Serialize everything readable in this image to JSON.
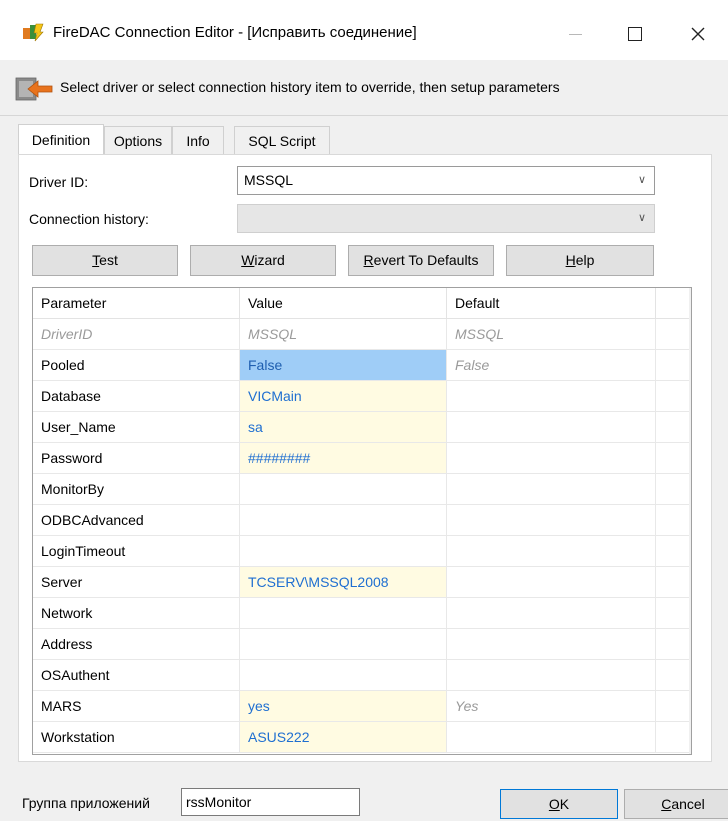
{
  "window": {
    "title": "FireDAC Connection Editor - [Исправить соединение]",
    "app_icon": "firedac-app-icon"
  },
  "info_bar": {
    "text": "Select driver or select connection history item to override, then setup parameters",
    "icon": "arrow-into-box-icon"
  },
  "tabs": [
    {
      "label": "Definition",
      "active": true
    },
    {
      "label": "Options",
      "active": false
    },
    {
      "label": "Info",
      "active": false
    },
    {
      "label": "SQL Script",
      "active": false
    }
  ],
  "driver": {
    "label": "Driver ID:",
    "value": "MSSQL"
  },
  "history": {
    "label": "Connection history:",
    "value": ""
  },
  "buttons": {
    "test": "Test",
    "wizard": "Wizard",
    "revert": "Revert To Defaults",
    "help": "Help"
  },
  "grid": {
    "headers": [
      "Parameter",
      "Value",
      "Default"
    ],
    "rows": [
      {
        "parameter": "DriverID",
        "value": "MSSQL",
        "default": "MSSQL",
        "state": "default"
      },
      {
        "parameter": "Pooled",
        "value": "False",
        "default": "False",
        "state": "selected"
      },
      {
        "parameter": "Database",
        "value": "VICMain",
        "default": "",
        "state": "modified"
      },
      {
        "parameter": "User_Name",
        "value": "sa",
        "default": "",
        "state": "modified"
      },
      {
        "parameter": "Password",
        "value": "########",
        "default": "",
        "state": "modified"
      },
      {
        "parameter": "MonitorBy",
        "value": "",
        "default": "",
        "state": "normal"
      },
      {
        "parameter": "ODBCAdvanced",
        "value": "",
        "default": "",
        "state": "normal"
      },
      {
        "parameter": "LoginTimeout",
        "value": "",
        "default": "",
        "state": "normal"
      },
      {
        "parameter": "Server",
        "value": "TCSERV\\MSSQL2008",
        "default": "",
        "state": "modified"
      },
      {
        "parameter": "Network",
        "value": "",
        "default": "",
        "state": "normal"
      },
      {
        "parameter": "Address",
        "value": "",
        "default": "",
        "state": "normal"
      },
      {
        "parameter": "OSAuthent",
        "value": "",
        "default": "",
        "state": "normal"
      },
      {
        "parameter": "MARS",
        "value": "yes",
        "default": "Yes",
        "state": "modified"
      },
      {
        "parameter": "Workstation",
        "value": "ASUS222",
        "default": "",
        "state": "modified"
      }
    ]
  },
  "footer": {
    "group_label": "Группа приложений",
    "group_value": "rssMonitor",
    "ok": "OK",
    "cancel": "Cancel"
  },
  "colors": {
    "value_text": "#1f6fd1",
    "modified_bg": "#fffbe2",
    "selected_bg": "#9fcdf7",
    "default_text": "#9a9a9a"
  }
}
